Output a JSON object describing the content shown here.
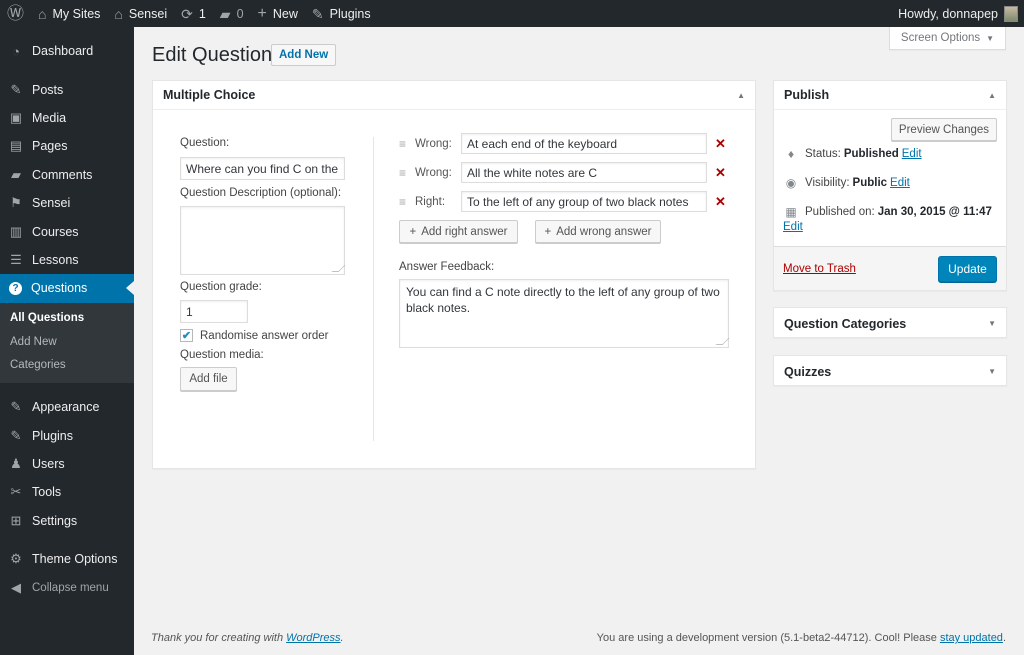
{
  "adminbar": {
    "items": [
      {
        "name": "wordpress-logo",
        "label": "",
        "icon": "Ⓦ"
      },
      {
        "name": "my-sites",
        "label": "My Sites",
        "icon": "⌂"
      },
      {
        "name": "site-name",
        "label": "Sensei",
        "icon": "⌂"
      },
      {
        "name": "updates",
        "label": "1",
        "icon": "⟳"
      },
      {
        "name": "comments",
        "label": "0",
        "icon": "▰"
      },
      {
        "name": "new-content",
        "label": "New",
        "icon": "+"
      },
      {
        "name": "plugins",
        "label": "Plugins",
        "icon": "✎"
      }
    ],
    "greeting": "Howdy, donnapep"
  },
  "sidebar": {
    "items": [
      {
        "label": "Dashboard",
        "icon": "◔"
      },
      {
        "label": "Posts",
        "icon": "✎"
      },
      {
        "label": "Media",
        "icon": "▣"
      },
      {
        "label": "Pages",
        "icon": "▤"
      },
      {
        "label": "Comments",
        "icon": "▰"
      },
      {
        "label": "Sensei",
        "icon": "⚑"
      },
      {
        "label": "Courses",
        "icon": "▥"
      },
      {
        "label": "Lessons",
        "icon": "☰"
      },
      {
        "label": "Questions",
        "icon": "?"
      }
    ],
    "submenu": [
      "All Questions",
      "Add New",
      "Categories"
    ],
    "items2": [
      {
        "label": "Appearance",
        "icon": "✎"
      },
      {
        "label": "Plugins",
        "icon": "✎"
      },
      {
        "label": "Users",
        "icon": "♟"
      },
      {
        "label": "Tools",
        "icon": "✂"
      },
      {
        "label": "Settings",
        "icon": "⊞"
      }
    ],
    "theme_options": {
      "label": "Theme Options",
      "icon": "⚙"
    },
    "collapse": {
      "label": "Collapse menu",
      "icon": "◀"
    }
  },
  "screen_options": {
    "label": "Screen Options",
    "icon": "▼"
  },
  "page": {
    "title": "Edit Question",
    "add_new": "Add New"
  },
  "question_box": {
    "title": "Multiple Choice",
    "question_label": "Question:",
    "question_value": "Where can you find C on the",
    "description_label": "Question Description (optional):",
    "description_value": "",
    "grade_label": "Question grade:",
    "grade_value": "1",
    "randomise_label": "Randomise answer order",
    "randomise_checked": true,
    "media_label": "Question media:",
    "add_file": "Add file",
    "answers": [
      {
        "type": "Wrong:",
        "value": "At each end of the keyboard"
      },
      {
        "type": "Wrong:",
        "value": "All the white notes are C"
      },
      {
        "type": "Right:",
        "value": "To the left of any group of two black notes"
      }
    ],
    "add_right": "Add right answer",
    "add_wrong": "Add wrong answer",
    "feedback_label": "Answer Feedback:",
    "feedback_value": "You can find a C note directly to the left of any group of two black notes."
  },
  "publish": {
    "title": "Publish",
    "preview": "Preview Changes",
    "status_label": "Status:",
    "status_value": "Published",
    "visibility_label": "Visibility:",
    "visibility_value": "Public",
    "published_label": "Published on:",
    "published_value": "Jan 30, 2015 @ 11:47",
    "edit": "Edit",
    "trash": "Move to Trash",
    "update": "Update"
  },
  "boxes": {
    "categories": "Question Categories",
    "quizzes": "Quizzes"
  },
  "footer": {
    "thanks": "Thank you for creating with ",
    "wp_link": "WordPress",
    "version_text": "You are using a development version (5.1-beta2-44712). Cool! Please ",
    "stay_updated": "stay updated"
  }
}
